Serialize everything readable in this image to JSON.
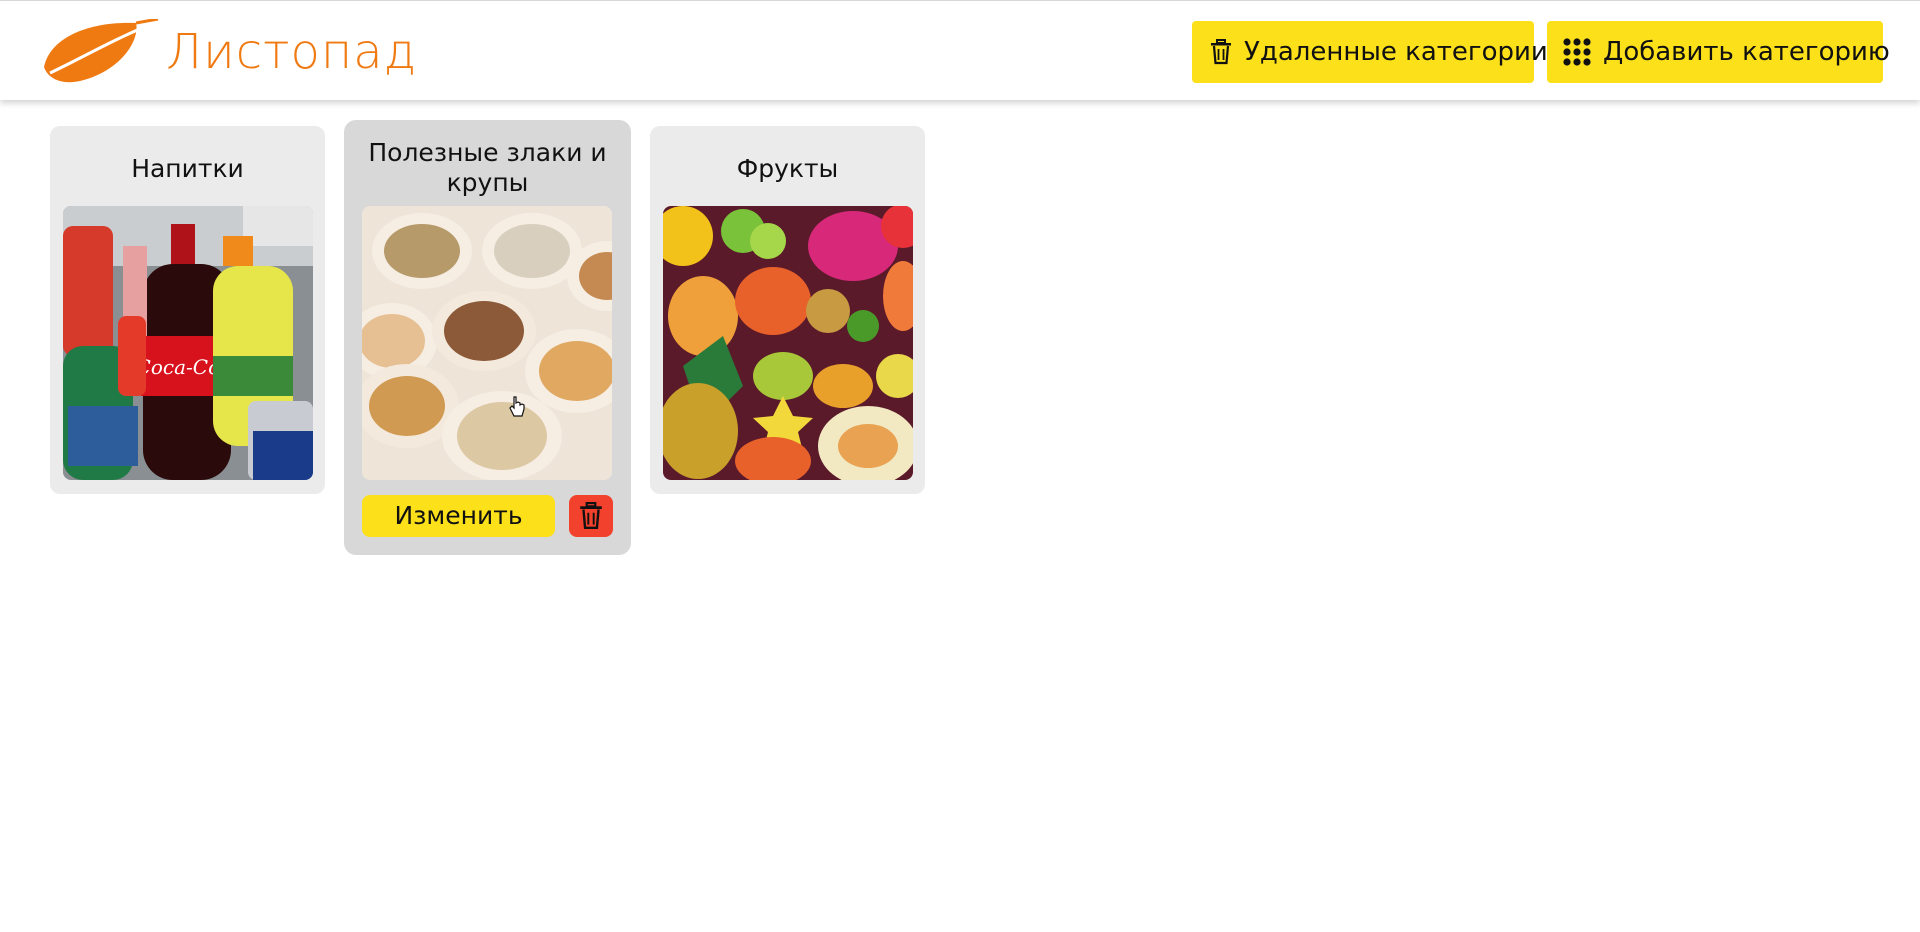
{
  "app": {
    "logo_text": "Листопад",
    "brand_color": "#f07a12"
  },
  "header": {
    "deleted_categories_label": "Удаленные категории",
    "deleted_categories_icon": "trash-icon",
    "add_category_label": "Добавить категорию",
    "add_category_icon": "grid-dots-icon",
    "button_color": "#fbe01a"
  },
  "categories": [
    {
      "title": "Напитки",
      "image": "drinks-image"
    },
    {
      "title": "Полезные злаки и крупы",
      "image": "grains-image"
    },
    {
      "title": "Фрукты",
      "image": "fruits-image"
    }
  ],
  "card_actions": {
    "edit_label": "Изменить",
    "delete_icon": "trash-icon",
    "delete_color": "#f2412c"
  }
}
